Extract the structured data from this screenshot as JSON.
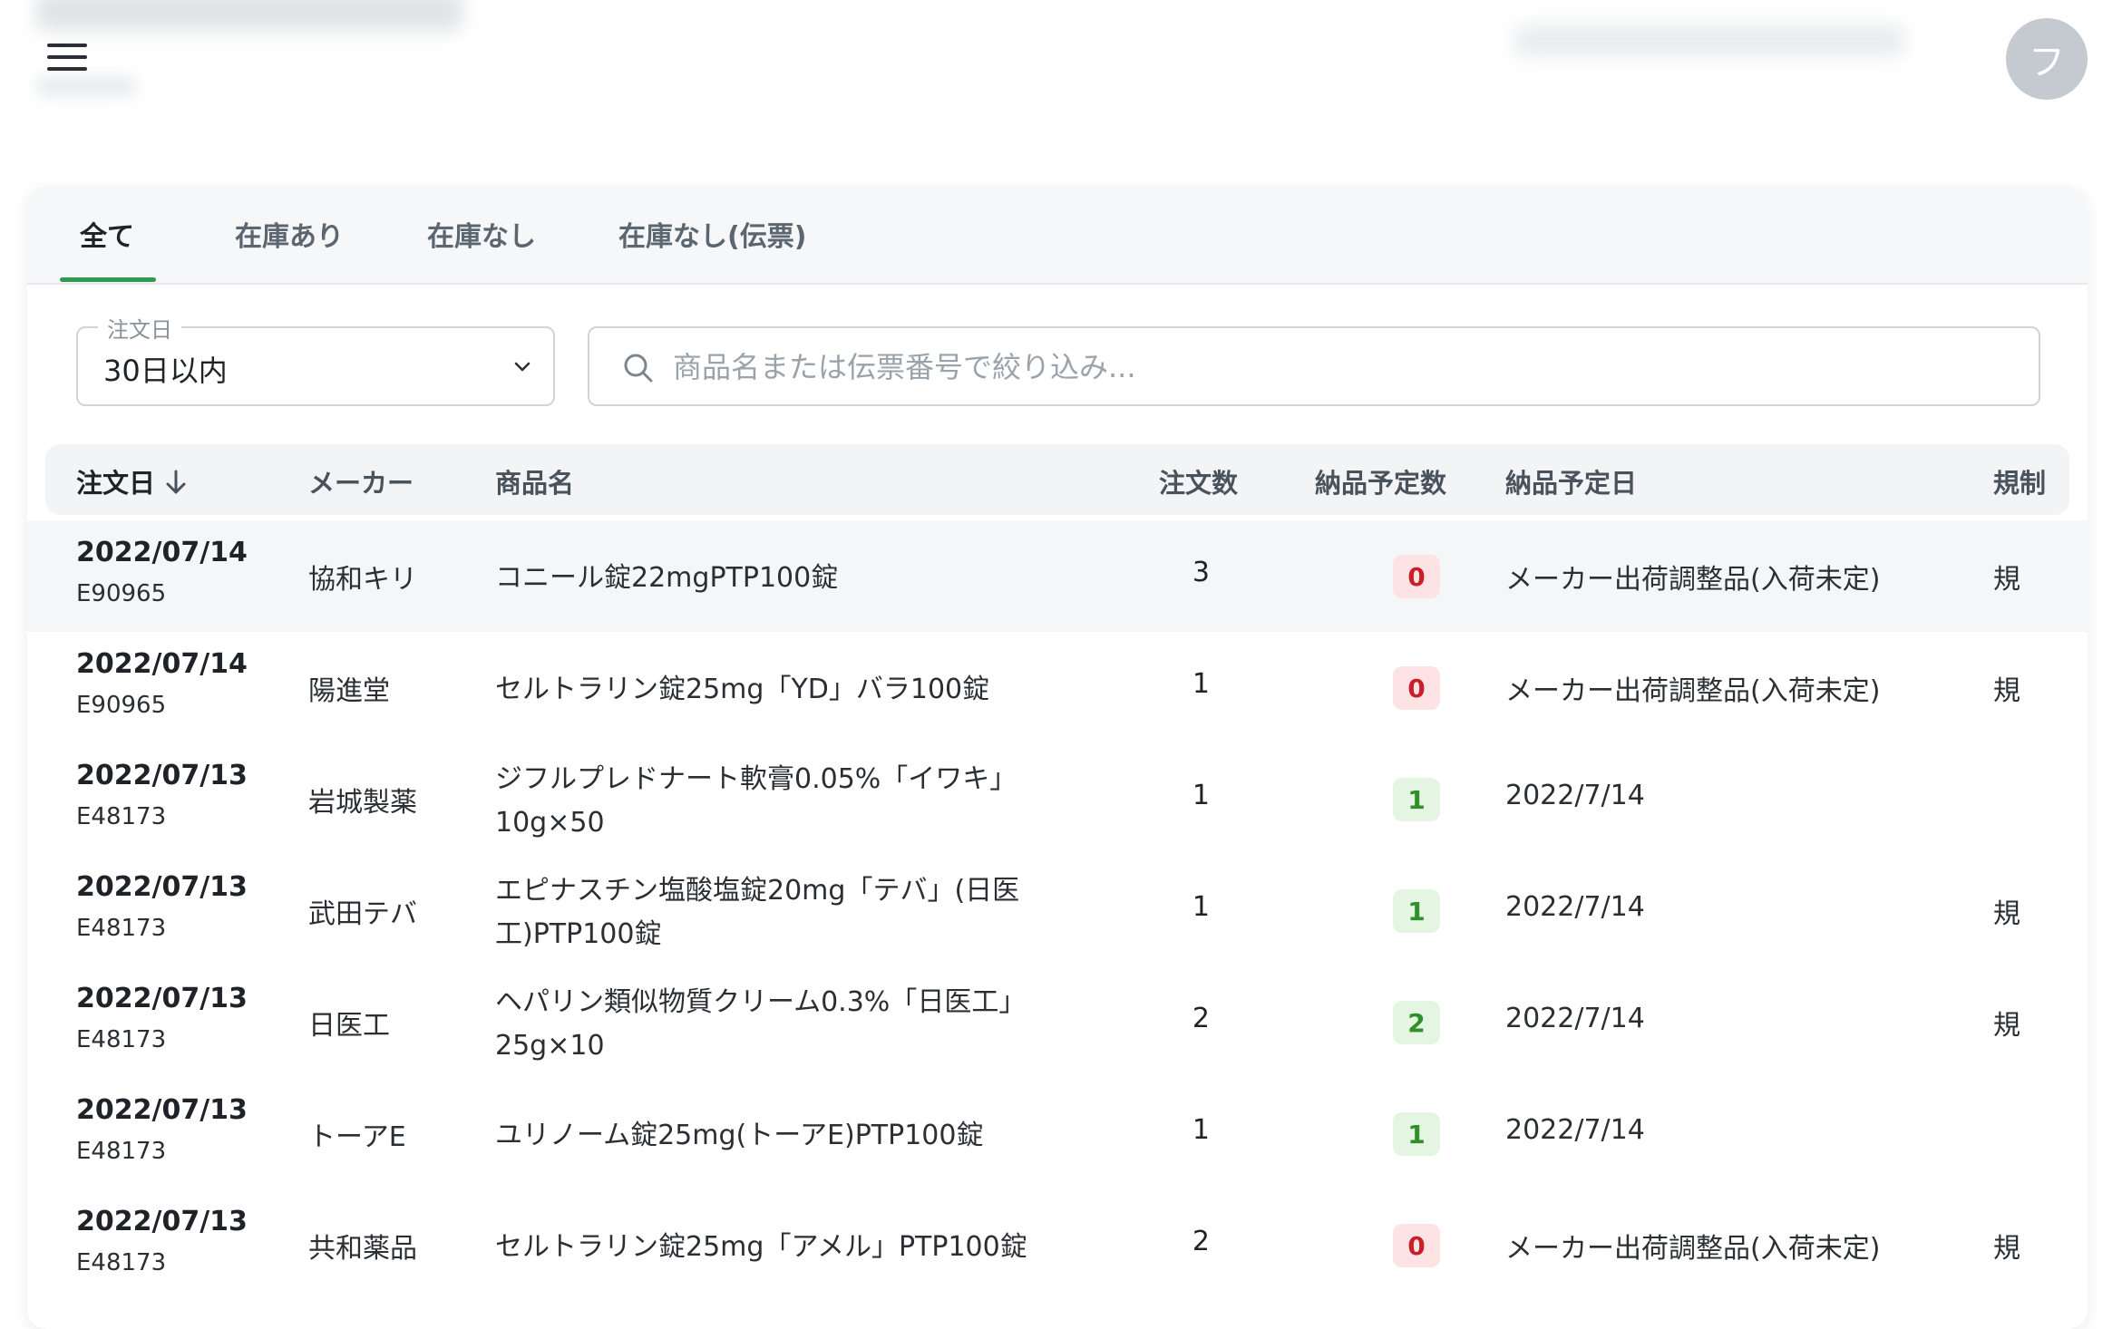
{
  "header": {
    "menu_icon": "hamburger-menu-icon",
    "avatar_initial": "フ"
  },
  "tabs": [
    {
      "label": "全て",
      "active": true
    },
    {
      "label": "在庫あり",
      "active": false
    },
    {
      "label": "在庫なし",
      "active": false
    },
    {
      "label": "在庫なし(伝票)",
      "active": false
    }
  ],
  "filters": {
    "date_label": "注文日",
    "date_value": "30日以内",
    "search_placeholder": "商品名または伝票番号で絞り込み..."
  },
  "table": {
    "columns": [
      "注文日",
      "メーカー",
      "商品名",
      "注文数",
      "納品予定数",
      "納品予定日",
      "規制"
    ],
    "sort_column": "注文日",
    "sort_direction": "desc",
    "rows": [
      {
        "date": "2022/07/14",
        "slip": "E90965",
        "maker": "協和キリ",
        "product_line1": "コニール錠22mgPTP100錠",
        "product_line2": "",
        "qty": "3",
        "planned": "0",
        "planned_status": "red",
        "delivery": "メーカー出荷調整品(入荷未定)",
        "reg": "規"
      },
      {
        "date": "2022/07/14",
        "slip": "E90965",
        "maker": "陽進堂",
        "product_line1": "セルトラリン錠25mg「YD」バラ100錠",
        "product_line2": "",
        "qty": "1",
        "planned": "0",
        "planned_status": "red",
        "delivery": "メーカー出荷調整品(入荷未定)",
        "reg": "規"
      },
      {
        "date": "2022/07/13",
        "slip": "E48173",
        "maker": "岩城製薬",
        "product_line1": "ジフルプレドナート軟膏0.05%「イワキ」",
        "product_line2": "10g×50",
        "qty": "1",
        "planned": "1",
        "planned_status": "green",
        "delivery": "2022/7/14",
        "reg": ""
      },
      {
        "date": "2022/07/13",
        "slip": "E48173",
        "maker": "武田テバ",
        "product_line1": "エピナスチン塩酸塩錠20mg「テバ」(日医",
        "product_line2": "工)PTP100錠",
        "qty": "1",
        "planned": "1",
        "planned_status": "green",
        "delivery": "2022/7/14",
        "reg": "規"
      },
      {
        "date": "2022/07/13",
        "slip": "E48173",
        "maker": "日医工",
        "product_line1": "ヘパリン類似物質クリーム0.3%「日医工」",
        "product_line2": "25g×10",
        "qty": "2",
        "planned": "2",
        "planned_status": "green",
        "delivery": "2022/7/14",
        "reg": "規"
      },
      {
        "date": "2022/07/13",
        "slip": "E48173",
        "maker": "トーアE",
        "product_line1": "ユリノーム錠25mg(トーアE)PTP100錠",
        "product_line2": "",
        "qty": "1",
        "planned": "1",
        "planned_status": "green",
        "delivery": "2022/7/14",
        "reg": ""
      },
      {
        "date": "2022/07/13",
        "slip": "E48173",
        "maker": "共和薬品",
        "product_line1": "セルトラリン錠25mg「アメル」PTP100錠",
        "product_line2": "",
        "qty": "2",
        "planned": "0",
        "planned_status": "red",
        "delivery": "メーカー出荷調整品(入荷未定)",
        "reg": "規"
      }
    ]
  },
  "colors": {
    "accent_green": "#2e9b4f",
    "badge_red_bg": "#fde3e3",
    "badge_red_text": "#c8202a",
    "badge_green_bg": "#e4f5e2",
    "badge_green_text": "#2f8f2b"
  }
}
